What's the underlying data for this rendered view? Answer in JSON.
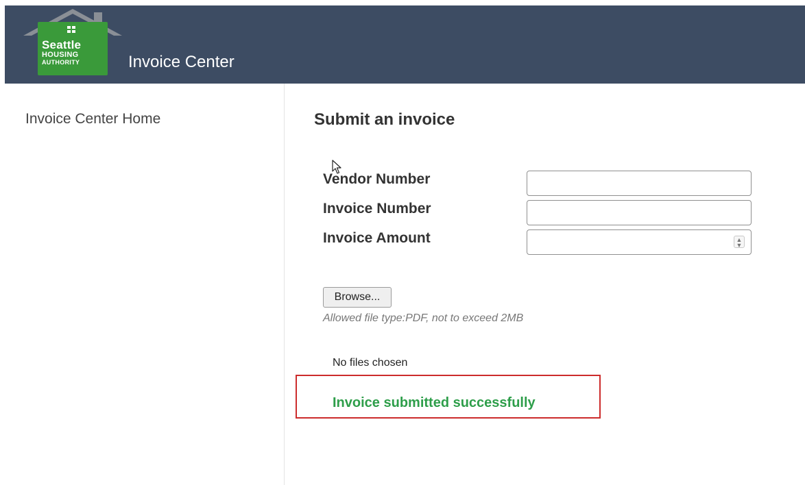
{
  "header": {
    "logo": {
      "line1": "Seattle",
      "line2": "HOUSING",
      "line3": "AUTHORITY",
      "brand_color": "#3a9a3a"
    },
    "app_title": "Invoice Center",
    "background_color": "#3d4c63"
  },
  "sidebar": {
    "items": [
      {
        "label": "Invoice Center Home"
      }
    ]
  },
  "main": {
    "title": "Submit an invoice",
    "fields": {
      "vendor_number": {
        "label": "Vendor Number",
        "value": "",
        "placeholder": ""
      },
      "invoice_number": {
        "label": "Invoice Number",
        "value": "",
        "placeholder": ""
      },
      "invoice_amount": {
        "label": "Invoice Amount",
        "value": "",
        "placeholder": ""
      }
    },
    "file_upload": {
      "browse_label": "Browse...",
      "hint": "Allowed file type:PDF, not to exceed 2MB",
      "status": "No files chosen"
    },
    "success_message": "Invoice submitted successfully",
    "success_color": "#2e9e4a",
    "highlight_color": "#cc2b2b"
  },
  "icons": {
    "logo_icon": "house-roof-logo",
    "spinner_icon": "number-spinner-icon",
    "cursor_icon": "mouse-pointer-icon"
  }
}
